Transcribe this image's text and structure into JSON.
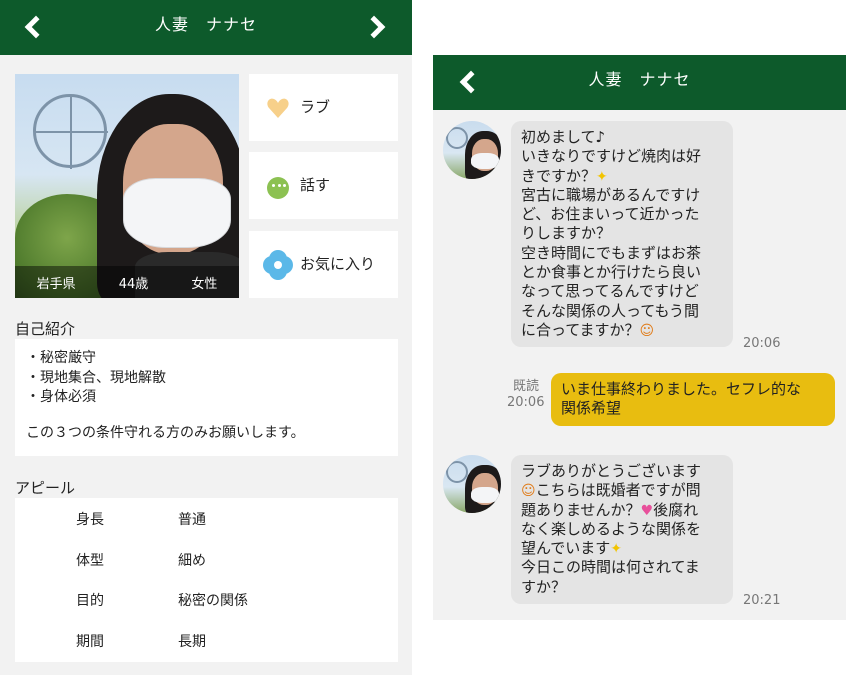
{
  "profile_screen": {
    "header": {
      "title": "人妻　ナナセ",
      "back_icon": "chevron-left-icon",
      "forward_icon": "chevron-right-icon"
    },
    "photo": {
      "location": "岩手県",
      "age": "44歳",
      "gender": "女性"
    },
    "actions": [
      {
        "label": "ラブ",
        "icon": "heart-icon"
      },
      {
        "label": "話す",
        "icon": "chat-bubble-icon"
      },
      {
        "label": "お気に入り",
        "icon": "flower-icon"
      }
    ],
    "intro": {
      "title": "自己紹介",
      "lines": [
        "・秘密厳守",
        "・現地集合、現地解散",
        "・身体必須"
      ],
      "note": "この３つの条件守れる方のみお願いします。"
    },
    "appeal": {
      "title": "アピール",
      "rows": [
        {
          "key": "身長",
          "value": "普通"
        },
        {
          "key": "体型",
          "value": "細め"
        },
        {
          "key": "目的",
          "value": "秘密の関係"
        },
        {
          "key": "期間",
          "value": "長期"
        }
      ]
    }
  },
  "chat_screen": {
    "header": {
      "title": "人妻　ナナセ",
      "back_icon": "chevron-left-icon"
    },
    "messages": [
      {
        "direction": "incoming",
        "lines": [
          "初めまして♪",
          "いきなりですけど焼肉は好",
          "きですか？",
          "宮古に職場があるんですけ",
          "ど、お住まいって近かった",
          "りしますか？",
          "空き時間にでもまずはお茶",
          "とか食事とか行けたら良い",
          "なって思ってるんですけど",
          "そんな関係の人ってもう間",
          "に合ってますか？"
        ],
        "emojis": [
          "sparkle-icon",
          "smiling-hearts-icon"
        ],
        "time": "20:06"
      },
      {
        "direction": "outgoing",
        "lines": [
          "いま仕事終わりました。セフレ的な",
          "関係希望"
        ],
        "read_label": "既読",
        "time": "20:06"
      },
      {
        "direction": "incoming",
        "lines": [
          "ラブありがとうございます",
          "こちらは既婚者ですが問",
          "題ありませんか？",
          "後腐れ",
          "なく楽しめるような関係を",
          "望んでいます",
          "今日この時間は何されてま",
          "すか？"
        ],
        "emojis": [
          "smiling-hearts-icon",
          "two-hearts-icon",
          "sparkle-icon"
        ],
        "time": "20:21"
      }
    ]
  },
  "colors": {
    "header_green": "#0d5a2b",
    "outgoing_bubble": "#e8bd10",
    "incoming_bubble": "#e4e4e4"
  }
}
